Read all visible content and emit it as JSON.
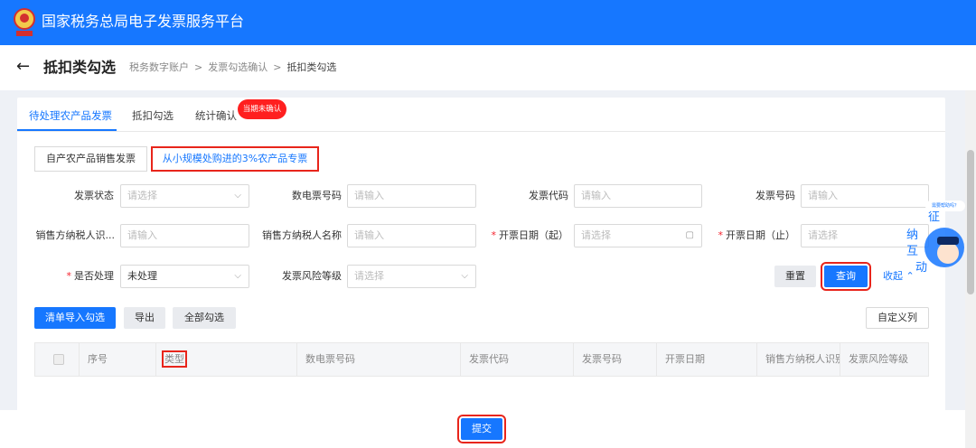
{
  "header": {
    "title": "国家税务总局电子发票服务平台"
  },
  "page": {
    "title": "抵扣类勾选",
    "breadcrumb": [
      "税务数字账户",
      ">",
      "发票勾选确认",
      ">",
      "抵扣类勾选"
    ]
  },
  "tabs": [
    {
      "label": "待处理农产品发票",
      "active": true
    },
    {
      "label": "抵扣勾选",
      "active": false
    },
    {
      "label": "统计确认",
      "active": false
    }
  ],
  "tab_badge": "当期未确认",
  "segments": [
    {
      "label": "自产农产品销售发票",
      "active": false
    },
    {
      "label": "从小规模处购进的3%农产品专票",
      "active": true
    }
  ],
  "filters": {
    "invoice_status": {
      "label": "发票状态",
      "placeholder": "请选择"
    },
    "e_invoice_no": {
      "label": "数电票号码",
      "placeholder": "请输入"
    },
    "invoice_code": {
      "label": "发票代码",
      "placeholder": "请输入"
    },
    "invoice_no": {
      "label": "发票号码",
      "placeholder": "请输入"
    },
    "seller_taxid": {
      "label": "销售方纳税人识...",
      "placeholder": "请输入"
    },
    "seller_name": {
      "label": "销售方纳税人名称",
      "placeholder": "请输入"
    },
    "date_start": {
      "required": "*",
      "label": "开票日期（起）",
      "placeholder": "请选择"
    },
    "date_end": {
      "required": "*",
      "label": "开票日期（止）",
      "placeholder": "请选择"
    },
    "processed": {
      "required": "*",
      "label": "是否处理",
      "value": "未处理"
    },
    "risk_level": {
      "label": "发票风险等级",
      "placeholder": "请选择"
    }
  },
  "actions": {
    "reset": "重置",
    "query": "查询",
    "collapse": "收起"
  },
  "toolbar": {
    "import": "清单导入勾选",
    "export": "导出",
    "select_all": "全部勾选",
    "custom_columns": "自定义列"
  },
  "table": {
    "columns": [
      "序号",
      "类型",
      "数电票号码",
      "发票代码",
      "发票号码",
      "开票日期",
      "销售方纳税人识别号",
      "发票风险等级"
    ]
  },
  "submit": "提交",
  "mascot": {
    "bubble": "需要帮助吗？",
    "chars": [
      "征",
      "纳",
      "互",
      "动"
    ]
  },
  "colors": {
    "primary": "#1677ff",
    "highlight": "#e8251b",
    "badge": "#ff1f1f"
  }
}
